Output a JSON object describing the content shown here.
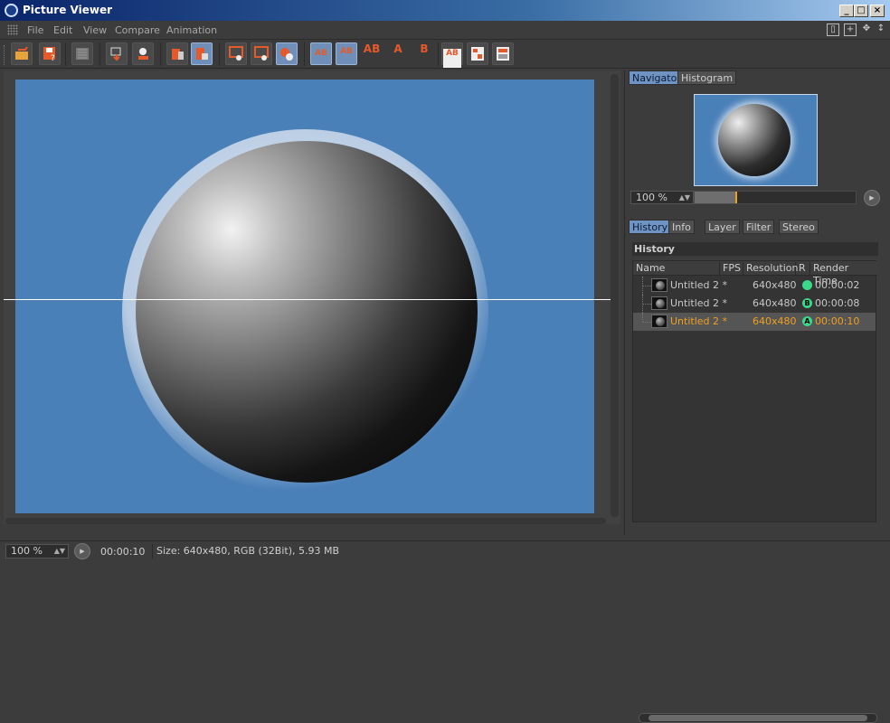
{
  "window": {
    "title": "Picture Viewer",
    "minimize": "_",
    "maximize": "□",
    "close": "×"
  },
  "menu": {
    "items": [
      "File",
      "Edit",
      "View",
      "Compare",
      "Animation"
    ]
  },
  "toolbar": {
    "icons": [
      "open-file-icon",
      "save-as-icon",
      "render-settings-icon",
      "export-icon",
      "import-icon",
      "delete-image-icon",
      "delete-all-icon",
      "view-layer-icon",
      "view-single-icon",
      "view-compare-icon",
      "compare-ab-icon",
      "compare-ab-split-icon",
      "ab-swap-icon",
      "set-a-icon",
      "set-b-icon",
      "ab-vertical-icon",
      "ab-horizontal-icon",
      "ab-difference-icon"
    ],
    "text_glyphs": {
      "ab": "AB",
      "a": "A",
      "b": "B"
    },
    "accent": "#e55a2b"
  },
  "navigator": {
    "tabs": [
      "Navigator",
      "Histogram"
    ],
    "active_tab": "Navigator",
    "zoom": "100 %",
    "zoom_fraction": 0.25
  },
  "history": {
    "tabs": [
      "History",
      "Info",
      "Layer",
      "Filter",
      "Stereo"
    ],
    "active_tab": "History",
    "header": "History",
    "columns": [
      "Name",
      "FPS",
      "Resolution",
      "R",
      "Render Time"
    ],
    "rows": [
      {
        "name": "Untitled 2 *",
        "resolution": "640x480",
        "marker": "",
        "render_time": "00:00:02",
        "selected": false
      },
      {
        "name": "Untitled 2 *",
        "resolution": "640x480",
        "marker": "B",
        "render_time": "00:00:08",
        "selected": false
      },
      {
        "name": "Untitled 2 *",
        "resolution": "640x480",
        "marker": "A",
        "render_time": "00:00:10",
        "selected": true
      }
    ],
    "selected_color": "#f0a020",
    "marker_color": "#38d98a"
  },
  "status": {
    "zoom": "100 %",
    "time": "00:00:10",
    "info": "Size: 640x480, RGB (32Bit), 5.93 MB"
  },
  "colors": {
    "canvas_bg": "#4a80b8",
    "title_gradient_start": "#0a246a"
  }
}
